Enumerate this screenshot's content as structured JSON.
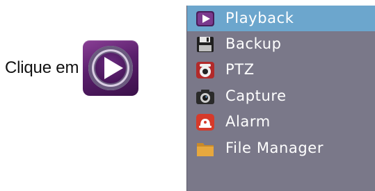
{
  "instruction": {
    "text": "Clique em",
    "icon": "playback-app-icon"
  },
  "menu": {
    "background": "#7a7889",
    "highlight": "#6ca6cd",
    "selected_index": 0,
    "items": [
      {
        "label": "Playback",
        "icon": "play-icon"
      },
      {
        "label": "Backup",
        "icon": "floppy-disk-icon"
      },
      {
        "label": "PTZ",
        "icon": "ptz-camera-icon"
      },
      {
        "label": "Capture",
        "icon": "camera-icon"
      },
      {
        "label": "Alarm",
        "icon": "alarm-bell-icon"
      },
      {
        "label": "File Manager",
        "icon": "folder-icon"
      }
    ]
  }
}
